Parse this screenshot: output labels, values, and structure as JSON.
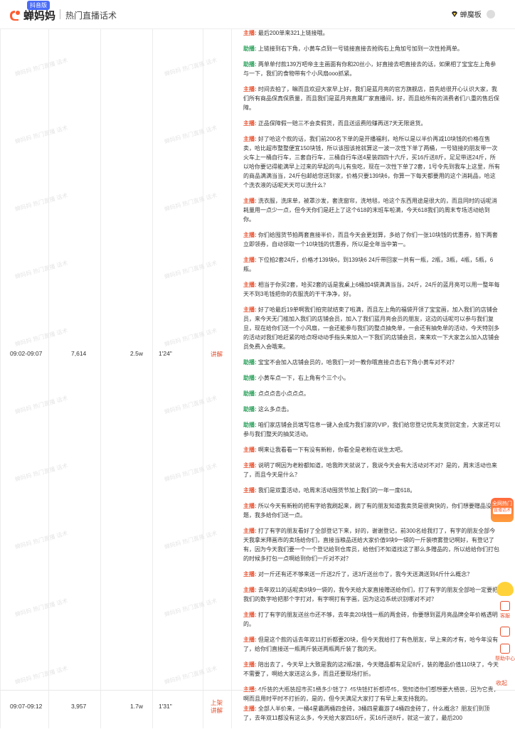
{
  "header": {
    "brand": "蝉妈妈",
    "version_badge": "抖音版",
    "title": "热门直播话术",
    "username": "蝉魔板"
  },
  "watermark": "蝉妈妈 热门直播 话术",
  "rows": [
    {
      "time": "09:02-09:07",
      "viewers": "7,614",
      "likes": "2.5w",
      "duration": "1'24\"",
      "type": "讲解",
      "lines": [
        {
          "speaker": "主播:",
          "text": "最后200单来321上链接哦。"
        },
        {
          "speaker": "助播:",
          "text": "上链接到右下角，小黄车点到一号链接直接去抢购右上角加号加到一次性抢两单。"
        },
        {
          "speaker": "助播:",
          "text": "两单单付款139万吧帝主主画面有你和20丝小，好直接去吧直接去的话，如果相了宝宝左上角参与一下，我们的食物带有个小风扇ooo抓紧。"
        },
        {
          "speaker": "主播:",
          "text": "时间去拍了，嘛而且欢迎大家早上好，我们是蓝月亮的官方旗舰店，首先给很开心认识大家，我们所有商品保真保质量，而且我们是蓝月亮直属厂家直播间，好，而且给所有的消费者们八重的售后保障。"
        },
        {
          "speaker": "主播:",
          "text": "正品保障假一赔三不会卖假货，而且送运费险赚再送7天无限退货。"
        },
        {
          "speaker": "主播:",
          "text": "好了哈这个款的话，我们前200名下单的是开播福利，哈所以是以半价再减10块钱的价格在售卖，哈比超市整整便宜150块钱，所以该囤该抢就算这一波一次性下单了两桶，一号链接的朋友带一次火车上一桶自行车，三套自行车，三桶自行车送4星装四四十六斤，买16斤送8斤，足足带送24斤，所以哈你要记得能满早上过来的早起的鸟儿有虫吃，现在一次性下单了2套，1号令先到我车上这里，所有的商品满满当当，24斤包邮给您送到家，价格只要139块6，你算一下每天都要用的这个消耗品，哈这个洗衣液的话呢天天可以洗什么？"
        },
        {
          "speaker": "主播:",
          "text": "洗衣服，洗床单，被罩沙发，套洗窗帘，洗地毯，哈这个东西用途是很大的，而且同时的话呢消耗量用一点少一点，但今天你们是赶上了这个618的末班车啦满，今天618我们的周末专场活动给到你。"
        },
        {
          "speaker": "主播:",
          "text": "你们给囤货节拍两套直接半价，而且今天会更划算，多给了你们一张10块钱的优惠券，拍下两套立即领券，自动领取一个10块钱的优惠券，所以是全年当中第一。"
        },
        {
          "speaker": "主播:",
          "text": "下位拍2套24斤，价格才139块6，到139块6 24斤带回家一共有一瓶，2瓶，3瓶，4瓶，5瓶，6瓶。"
        },
        {
          "speaker": "主播:",
          "text": "相当于你买2套，哈买2套的话是我桌上6桶加4袋满满当当，24斤，24斤的蓝月亮可以用一整年每天不到3毛钱把你的衣服洗的干干净净，好。"
        },
        {
          "speaker": "主播:",
          "text": "好了哈最后19单啊我们拍完就结束了啦满，而且左上角的福袋开领了宝宝画，加入我们的店铺会员，来今天无门槛加入我们的店铺会员，加入了我们蓝月亮会员的朋友，这边的话呢可以参与我们复旦，现在给你们送一个小风扇，一会还能参与我们的整点抽免单，一会还有抽免单的活动，今天特别多的活动对我们哈赶紧的哈点呀动动手指头来加入一下我们的店铺会员，来来欢一下大家怎么加入店铺会员免费入会哦来。"
        },
        {
          "speaker": "助播:",
          "text": "宝宝不会加入店铺会员的，哈我们一对一教你哦直接点击右下角小黄车对不对？"
        },
        {
          "speaker": "助播:",
          "text": "小黄车点一下，右上角有个三个小。"
        },
        {
          "speaker": "助播:",
          "text": "点点点击小点点点。"
        },
        {
          "speaker": "助播:",
          "text": "这么多点击。"
        },
        {
          "speaker": "助播:",
          "text": "咱们家店铺会员填写信息一键入会成为我们家的VIP，我们给您登记优先发货别定金，大家还可以参与我们整天的抽奖活动。"
        },
        {
          "speaker": "主播:",
          "text": "啊来让我看看一下有没有新粉，你看全是老粉在说生太吧。"
        },
        {
          "speaker": "主播:",
          "text": "说明了啊因为老粉都知道，哈我昨天就说了，我说今天会有大活动对不对？是的，周末活动也来了，而且今天是什么？"
        },
        {
          "speaker": "主播:",
          "text": "我们是双重活动，哈周末活动囤货节加上我们的一年一度618。"
        },
        {
          "speaker": "主播:",
          "text": "所以今天有新粉的把有字给我刷起来，刷了有的朋友知道我卖货是很爽快的，你们想要赠品没问题，我多给你们送一点。"
        },
        {
          "speaker": "主播:",
          "text": "打了有字的朋友看好了全部登记下来，好的，谢谢登记，前300名给我打了，有字的朋友全部今天我拿米拜画市的卖场给你们，直接当粮品送给大家价值9块9一袋的一斤装喷雾登记啊好，有登记了有，因为今天我们要一个一个登记给到仓库员，给他们不知道找这了那么多赠品的，所以给给你们打包的时候多打包一点啊给到你们一斤对不对？"
        },
        {
          "speaker": "主播:",
          "text": "对一斤还有还不够来送一斤送2斤了，送3斤送丝巾了，我今天送满送到4斤什么概念？"
        },
        {
          "speaker": "主播:",
          "text": "去年双11的话呢卖9块9一袋的，我今天给大家直接赠送给你们，打了有字的朋友全部哈一定要把我们的数字哈把那个字打对，有字啊打有字画，因为这边系统识别哪对不对？"
        },
        {
          "speaker": "主播:",
          "text": "打了有字的朋友送丝巾还不够，去年卖20块钱一瓶的两金砖，你要想到蓝月亮品牌全年价格透明的。"
        },
        {
          "speaker": "主播:",
          "text": "但是这个款的话去年双11打折都要20块，但今天我给打了有色朋友，早上来的才有，哈今年没有了，给你们直接送一瓶两斤装送两瓶两斤装了我的天。"
        },
        {
          "speaker": "主播:",
          "text": "陪出去了，今天早上大致是我的这2瓶2装，今天赠品都有足足8斤，装的赠品价值110块了，今天不需要了，啊给大家送这么多，而且还要现场打折。"
        },
        {
          "speaker": "主播:",
          "text": "4斤装的大瓶装超市买1桶多少钱了？45块钱打折都得45，我知道你们都想要大桶装，因为它贵，啊而且用时平时不打折的，是的，但今天满足大家打了有早上来支持我的。"
        }
      ]
    },
    {
      "time": "09:07-09:12",
      "viewers": "3,957",
      "likes": "1.7w",
      "duration": "1'31\"",
      "type_line1": "上架",
      "type_line2": "讲解",
      "lines": [
        {
          "speaker": "主播:",
          "text": "全部人半价来，一桶4星霸两桶四金砖，3桶四星霸游了4桶四金砖了，什么概念？朋友们到顶了，去年双11都没有这么多，今天给大家四16斤，买16斤送8斤，就这一波了，最后200"
        }
      ]
    }
  ],
  "collapse_label": "收起",
  "float_badge": {
    "line1": "全网热门",
    "line2": "直播话术"
  },
  "side_panel": {
    "kefu": "客服",
    "help": "帮助中心"
  }
}
